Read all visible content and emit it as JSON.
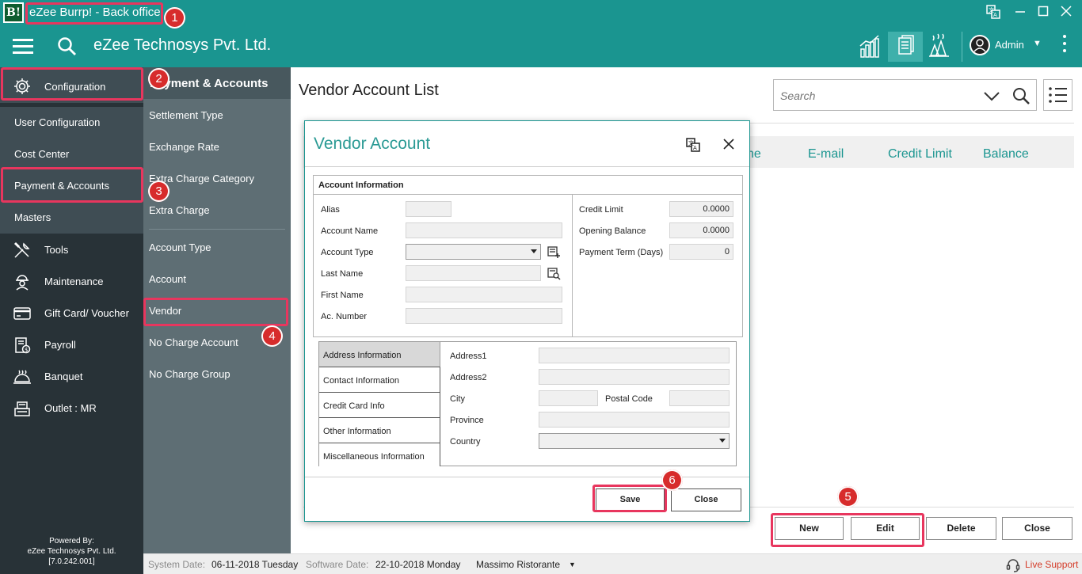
{
  "app": {
    "logo_text": "B!",
    "window_title": "eZee Burrp! - Back office"
  },
  "header": {
    "company": "eZee Technosys Pvt. Ltd.",
    "user": "Admin"
  },
  "sidebar": {
    "config_label": "Configuration",
    "sub_items": [
      "User Configuration",
      "Cost Center",
      "Payment & Accounts",
      "Masters"
    ],
    "items": [
      "Tools",
      "Maintenance",
      "Gift Card/ Voucher",
      "Payroll",
      "Banquet",
      "Outlet : MR"
    ],
    "powered_line1": "Powered By:",
    "powered_line2": "eZee Technosys Pvt. Ltd.",
    "powered_line3": "[7.0.242.001]"
  },
  "submenu": {
    "header": "Payment & Accounts",
    "items_a": [
      "Settlement Type",
      "Exchange Rate",
      "Extra Charge Category",
      "Extra Charge"
    ],
    "items_b": [
      "Account Type",
      "Account",
      "Vendor",
      "No Charge Account",
      "No Charge Group"
    ]
  },
  "main": {
    "title": "Vendor Account List",
    "search_placeholder": "Search",
    "columns": [
      "ne",
      "E-mail",
      "Credit Limit",
      "Balance"
    ],
    "buttons": {
      "new": "New",
      "edit": "Edit",
      "delete": "Delete",
      "close": "Close"
    }
  },
  "modal": {
    "title": "Vendor Account",
    "section": "Account Information",
    "labels": {
      "alias": "Alias",
      "account_name": "Account Name",
      "account_type": "Account Type",
      "last_name": "Last Name",
      "first_name": "First Name",
      "ac_number": "Ac. Number",
      "credit_limit": "Credit Limit",
      "opening_balance": "Opening Balance",
      "payment_term": "Payment Term (Days)"
    },
    "values": {
      "credit_limit": "0.0000",
      "opening_balance": "0.0000",
      "payment_term": "0"
    },
    "tabs": [
      "Address Information",
      "Contact Information",
      "Credit Card Info",
      "Other Information",
      "Miscellaneous Information"
    ],
    "address": {
      "address1": "Address1",
      "address2": "Address2",
      "city": "City",
      "postal_code": "Postal Code",
      "province": "Province",
      "country": "Country"
    },
    "save": "Save",
    "close": "Close"
  },
  "status": {
    "system_date_label": "System Date:",
    "system_date": "06-11-2018 Tuesday",
    "software_date_label": "Software Date:",
    "software_date": "22-10-2018 Monday",
    "outlet": "Massimo Ristorante",
    "live_support": "Live Support"
  },
  "callouts": [
    "1",
    "2",
    "3",
    "4",
    "5",
    "6"
  ],
  "colors": {
    "teal": "#1a9590",
    "sidebar": "#283237",
    "highlight": "#e8365e",
    "badge": "#d72c2c"
  }
}
